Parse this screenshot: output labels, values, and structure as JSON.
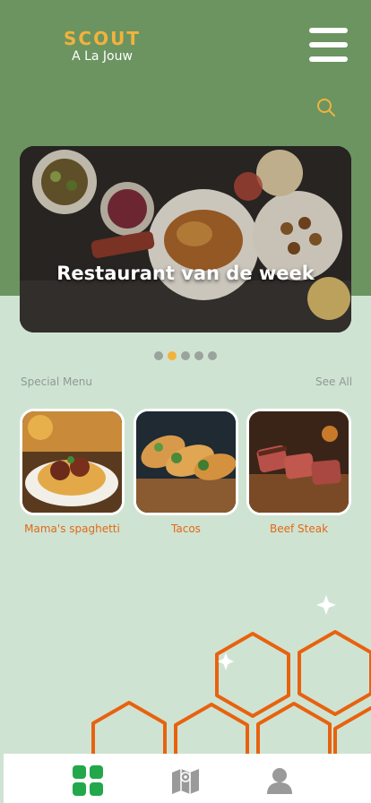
{
  "app": {
    "brand_name": "SCOUT",
    "brand_tagline": "A La Jouw"
  },
  "colors": {
    "header": "#6b9461",
    "background": "#cfe3d3",
    "accent": "#f2b23c",
    "label": "#e06a14",
    "nav_active": "#22a84a",
    "nav_inactive": "#9a9a9a"
  },
  "icons": {
    "menu": "hamburger-icon",
    "search": "search-icon",
    "home": "grid-icon",
    "map": "map-icon",
    "profile": "user-icon"
  },
  "hero": {
    "title": "Restaurant van de week",
    "slides_count": 5,
    "active_slide": 2
  },
  "special_menu": {
    "title": "Special Menu",
    "see_all": "See All",
    "items": [
      {
        "label": "Mama's spaghetti"
      },
      {
        "label": "Tacos"
      },
      {
        "label": "Beef Steak"
      }
    ]
  },
  "bottom_nav": {
    "active": "home"
  }
}
